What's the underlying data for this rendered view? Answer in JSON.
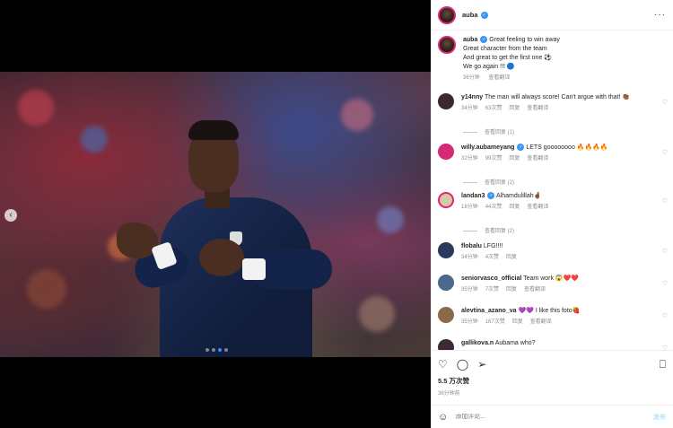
{
  "post": {
    "username": "auba",
    "caption_lines": [
      "Great feeling to win away",
      "Great character from the team",
      "And great to get the first one ⚽",
      "We go again !!! 🔵"
    ],
    "caption_time": "36分钟",
    "caption_translate": "查看翻译",
    "likes": "5.5 万次赞",
    "time": "36分钟前"
  },
  "carousel": {
    "total": 4,
    "active_index": 2
  },
  "comments": [
    {
      "user": "y14nny",
      "verified": false,
      "text": "The man will always score! Can't argue with that! 👏🏾",
      "time": "34分钟",
      "likes": "63次赞",
      "reply": "回复",
      "translate": "查看翻译",
      "replies": "查看回复 (1)"
    },
    {
      "user": "willy.aubameyang",
      "verified": true,
      "text": "LETS goooooooo 🔥🔥🔥🔥",
      "time": "32分钟",
      "likes": "99次赞",
      "reply": "回复",
      "translate": "查看翻译",
      "replies": "查看回复 (2)"
    },
    {
      "user": "landan3",
      "verified": true,
      "text": "Alhamdulillah🤞🏾",
      "time": "18分钟",
      "likes": "44次赞",
      "reply": "回复",
      "translate": "查看翻译",
      "replies": "查看回复 (2)"
    },
    {
      "user": "flobalu",
      "verified": false,
      "text": "LFG!!!!",
      "time": "34分钟",
      "likes": "4次赞",
      "reply": "回复",
      "translate": "",
      "replies": ""
    },
    {
      "user": "seniorvasco_official",
      "verified": false,
      "text": "Team work 😱❤️❤️",
      "time": "35分钟",
      "likes": "7次赞",
      "reply": "回复",
      "translate": "查看翻译",
      "replies": ""
    },
    {
      "user": "alevtina_azano_va",
      "verified": false,
      "text": "💜💜 I like this foto🍓",
      "time": "35分钟",
      "likes": "167次赞",
      "reply": "回复",
      "translate": "查看翻译",
      "replies": ""
    },
    {
      "user": "gallikova.n",
      "verified": false,
      "text": "Aubama who?",
      "time": "",
      "likes": "",
      "reply": "",
      "translate": "",
      "replies": ""
    }
  ],
  "add_comment": {
    "placeholder": "添加评论...",
    "post_label": "发布"
  }
}
